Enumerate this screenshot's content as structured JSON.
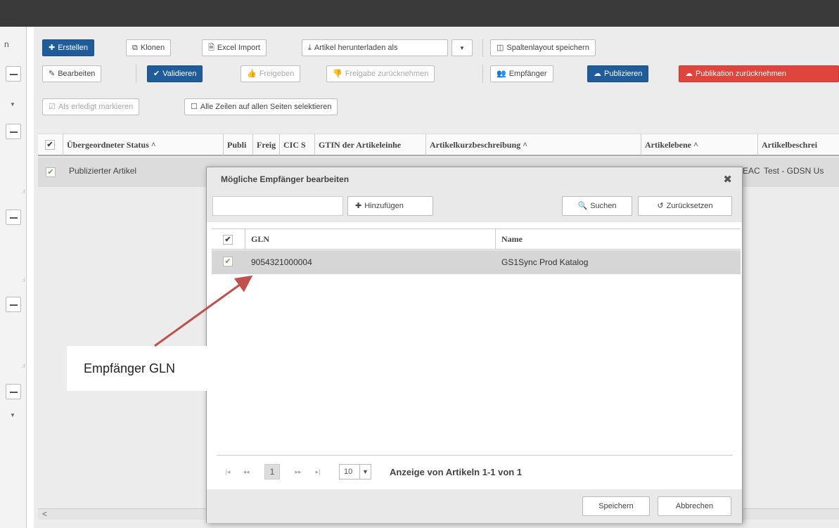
{
  "left_strip": {
    "partial_label": "n"
  },
  "toolbar": {
    "row1": [
      {
        "label": "Erstellen",
        "icon": "plus-icon"
      },
      {
        "label": "Klonen",
        "icon": "copy-icon"
      },
      {
        "label": "Excel Import",
        "icon": "file-icon"
      },
      {
        "label": "Artikel herunterladen als",
        "icon": "download-icon"
      },
      {
        "label": "Spaltenlayout speichern",
        "icon": "columns-icon"
      }
    ],
    "row2": [
      {
        "label": "Bearbeiten",
        "icon": "pencil-icon"
      },
      {
        "label": "Validieren",
        "icon": "check-icon"
      },
      {
        "label": "Freigeben",
        "icon": "thumbs-up-icon"
      },
      {
        "label": "Freigabe zurücknehmen",
        "icon": "thumbs-down-icon"
      },
      {
        "label": "Empfänger",
        "icon": "users-icon"
      },
      {
        "label": "Publizieren",
        "icon": "cloud-upload-icon"
      },
      {
        "label": "Publikation zurücknehmen",
        "icon": "cloud-upload-icon"
      }
    ],
    "row3": [
      {
        "label": "Als erledigt markieren",
        "icon": "checkbox-icon"
      },
      {
        "label": "Alle Zeilen auf allen Seiten selektieren",
        "icon": "square-icon"
      }
    ]
  },
  "grid": {
    "columns": [
      "Übergeordneter Status ^",
      "Publi",
      "Freig",
      "CIC S",
      "GTIN der Artikeleinhe",
      "Artikelkurzbeschreibung ^",
      "Artikelebene ^",
      "Artikelbeschrei"
    ],
    "row": {
      "status": "Publizierter Artikel",
      "partial_level": "EAC",
      "description": "Test - GDSN Us"
    }
  },
  "modal": {
    "title": "Mögliche Empfänger bearbeiten",
    "search_value": "",
    "add_label": "Hinzufügen",
    "search_label": "Suchen",
    "reset_label": "Zurücksetzen",
    "columns": [
      "GLN",
      "Name"
    ],
    "rows": [
      {
        "gln": "9054321000004",
        "name": "GS1Sync Prod Katalog"
      }
    ],
    "pager": {
      "page": "1",
      "page_size": "10",
      "info": "Anzeige von Artikeln 1-1 von 1"
    },
    "save_label": "Speichern",
    "cancel_label": "Abbrechen"
  },
  "annotation": {
    "label": "Empfänger GLN"
  },
  "colors": {
    "primary": "#1f5c99",
    "danger": "#e0453d",
    "arrow": "#c0504d",
    "check": "#6ba540"
  }
}
